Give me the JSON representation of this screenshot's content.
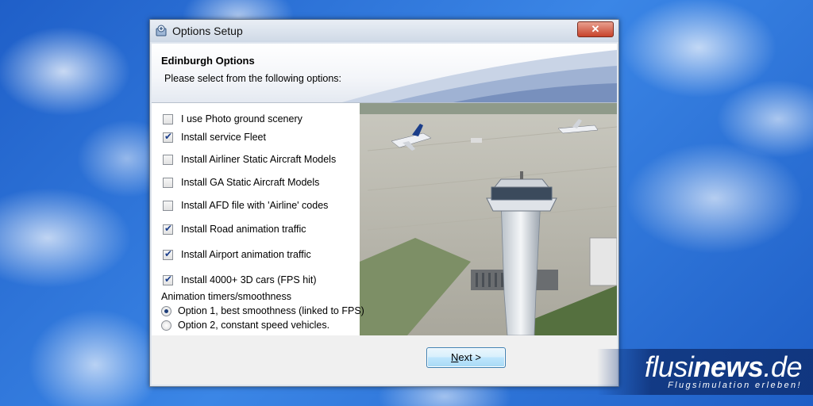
{
  "window": {
    "title": "Options Setup",
    "close_label": "✕"
  },
  "header": {
    "title": "Edinburgh Options",
    "subtitle": "Please select from the following options:"
  },
  "options": {
    "checkboxes": [
      {
        "label": "I use Photo ground scenery",
        "checked": false
      },
      {
        "label": "Install service Fleet",
        "checked": true
      },
      {
        "label": "Install Airliner Static Aircraft Models",
        "checked": false
      },
      {
        "label": "Install GA Static Aircraft Models",
        "checked": false
      },
      {
        "label": "Install AFD file with 'Airline' codes",
        "checked": false
      },
      {
        "label": "Install Road animation traffic",
        "checked": true
      },
      {
        "label": "Install Airport animation traffic",
        "checked": true
      },
      {
        "label": "Install 4000+ 3D cars (FPS hit)",
        "checked": true
      }
    ],
    "group_label": "Animation timers/smoothness",
    "radios": [
      {
        "label": "Option 1, best smoothness  (linked to FPS)",
        "checked": true
      },
      {
        "label": "Option 2, constant speed vehicles.",
        "checked": false
      }
    ]
  },
  "footer": {
    "next_mnemonic": "N",
    "next_rest": "ext >"
  },
  "watermark": {
    "name_regular": "flusi",
    "name_bold": "news",
    "name_suffix": ".de",
    "tagline": "Flugsimulation erleben!"
  }
}
